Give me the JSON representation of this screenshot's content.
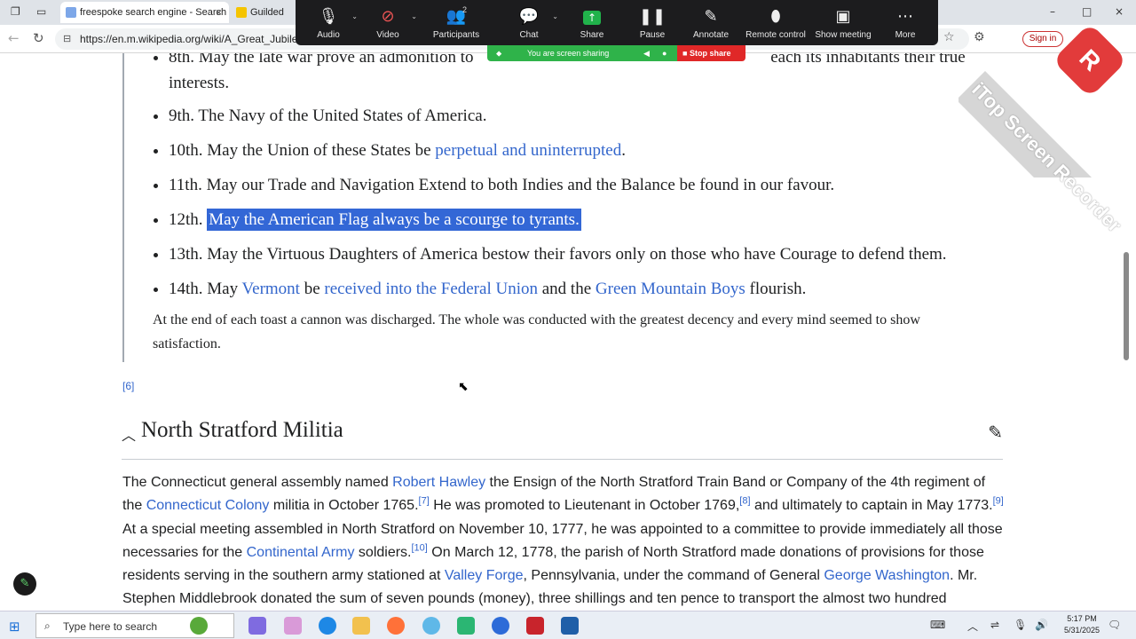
{
  "browser": {
    "tabs": [
      {
        "title": "freespoke search engine - Search",
        "close": "×"
      },
      {
        "title": "Guilded"
      }
    ],
    "url": "https://en.m.wikipedia.org/wiki/A_Great_Jubilee_",
    "signin_label": "Sign in",
    "window_controls": [
      "–",
      "□",
      "×"
    ]
  },
  "zoom": {
    "items": [
      {
        "label": "Audio",
        "icon": "microphone-icon"
      },
      {
        "label": "Video",
        "icon": "video-off-icon"
      },
      {
        "label": "Participants",
        "icon": "participants-icon",
        "count": "2"
      },
      {
        "label": "Chat",
        "icon": "chat-icon"
      },
      {
        "label": "Share",
        "icon": "share-screen-icon"
      },
      {
        "label": "Pause",
        "icon": "pause-icon"
      },
      {
        "label": "Annotate",
        "icon": "pencil-icon"
      },
      {
        "label": "Remote control",
        "icon": "mouse-icon"
      },
      {
        "label": "Show meeting",
        "icon": "show-meeting-icon"
      },
      {
        "label": "More",
        "icon": "more-icon"
      }
    ],
    "sharing_status": "You are screen sharing",
    "stop_share": "Stop share",
    "accent": "#2fb34a",
    "stop_color": "#e02828"
  },
  "watermark": {
    "text": "iTop Screen Recorder"
  },
  "article": {
    "toasts": {
      "t8_text": "8th. May the late war prove an admonition to ",
      "t8_tail": "each its inhabitants their true interests.",
      "t9": "9th. The Navy of the United States of America.",
      "t10_pre": "10th. May the Union of these States be ",
      "t10_link": "perpetual and uninterrupted",
      "t10_post": ".",
      "t11": "11th. May our Trade and Navigation Extend to both Indies and the Balance be found in our favour.",
      "t12_pre": "12th. ",
      "t12_selected": "May the American Flag always be a scourge to tyrants.",
      "t13": "13th. May the Virtuous Daughters of America bestow their favors only on those who have Courage to defend them.",
      "t14_pre": "14th. May ",
      "t14_link1": "Vermont",
      "t14_mid1": " be ",
      "t14_link2": "received into the Federal Union",
      "t14_mid2": " and the ",
      "t14_link3": "Green Mountain Boys",
      "t14_post": " flourish."
    },
    "closing": "At the end of each toast a cannon was discharged. The whole was conducted with the greatest decency and every mind seemed to show satisfaction.",
    "ref": "[6]",
    "section_title": "North Stratford Militia",
    "para": {
      "s1": "The Connecticut general assembly named ",
      "l1": "Robert Hawley",
      "s2": " the Ensign of the North Stratford Train Band or Company of the 4th regiment of the ",
      "l2": "Connecticut Colony",
      "s3": " militia in October 1765.",
      "r7": "[7]",
      "s4": " He was promoted to Lieutenant in October 1769,",
      "r8": "[8]",
      "s5": " and ultimately to captain in May 1773.",
      "r9": "[9]",
      "s6": " At a special meeting assembled in North Stratford on November 10, 1777, he was appointed to a committee to provide immediately all those necessaries for the ",
      "l3": "Continental Army",
      "s7": " soldiers.",
      "r10": "[10]",
      "s8": " On March 12, 1778, the parish of North Stratford made donations of provisions for those residents serving in the southern army stationed at ",
      "l4": "Valley Forge",
      "s9": ", Pennsylvania, under the command of General ",
      "l5": "George Washington",
      "s10": ". Mr. Stephen Middlebrook donated the sum of seven pounds (money), three shillings and ten pence to transport the almost two hundred"
    },
    "link_color": "#3366cc",
    "selection_color": "#3367d6"
  },
  "taskbar": {
    "search_placeholder": "Type here to search",
    "time": "5:17 PM",
    "date": "5/31/2025"
  }
}
